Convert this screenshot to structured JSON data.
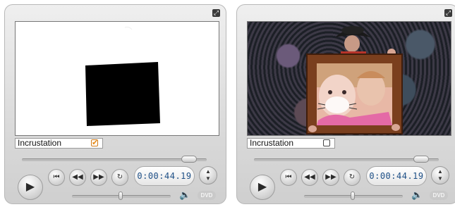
{
  "players": [
    {
      "overlay_label": "Incrustation",
      "overlay_checked": true,
      "checkbox_glyph": "✔",
      "timecode": "0:00:44.19",
      "scrub_position": 0.84,
      "volume": 0.5,
      "preview": "white-matte-with-black-square"
    },
    {
      "overlay_label": "Incrustation",
      "overlay_checked": false,
      "checkbox_glyph": "",
      "timecode": "0:00:44.19",
      "scrub_position": 0.84,
      "volume": 0.5,
      "preview": "child-in-picture-frame"
    }
  ],
  "icons": {
    "play": "▶",
    "go_start": "⏮",
    "rewind": "◀◀",
    "forward": "▶▶",
    "loop": "↻",
    "spin_up": "▲",
    "spin_down": "▼",
    "expand": "⤢",
    "speaker": "🔈",
    "dvd": "DVD"
  },
  "colors": {
    "checkbox_on": "#e88a14",
    "timecode": "#1d4f86",
    "frame": "#7a3f1e"
  }
}
